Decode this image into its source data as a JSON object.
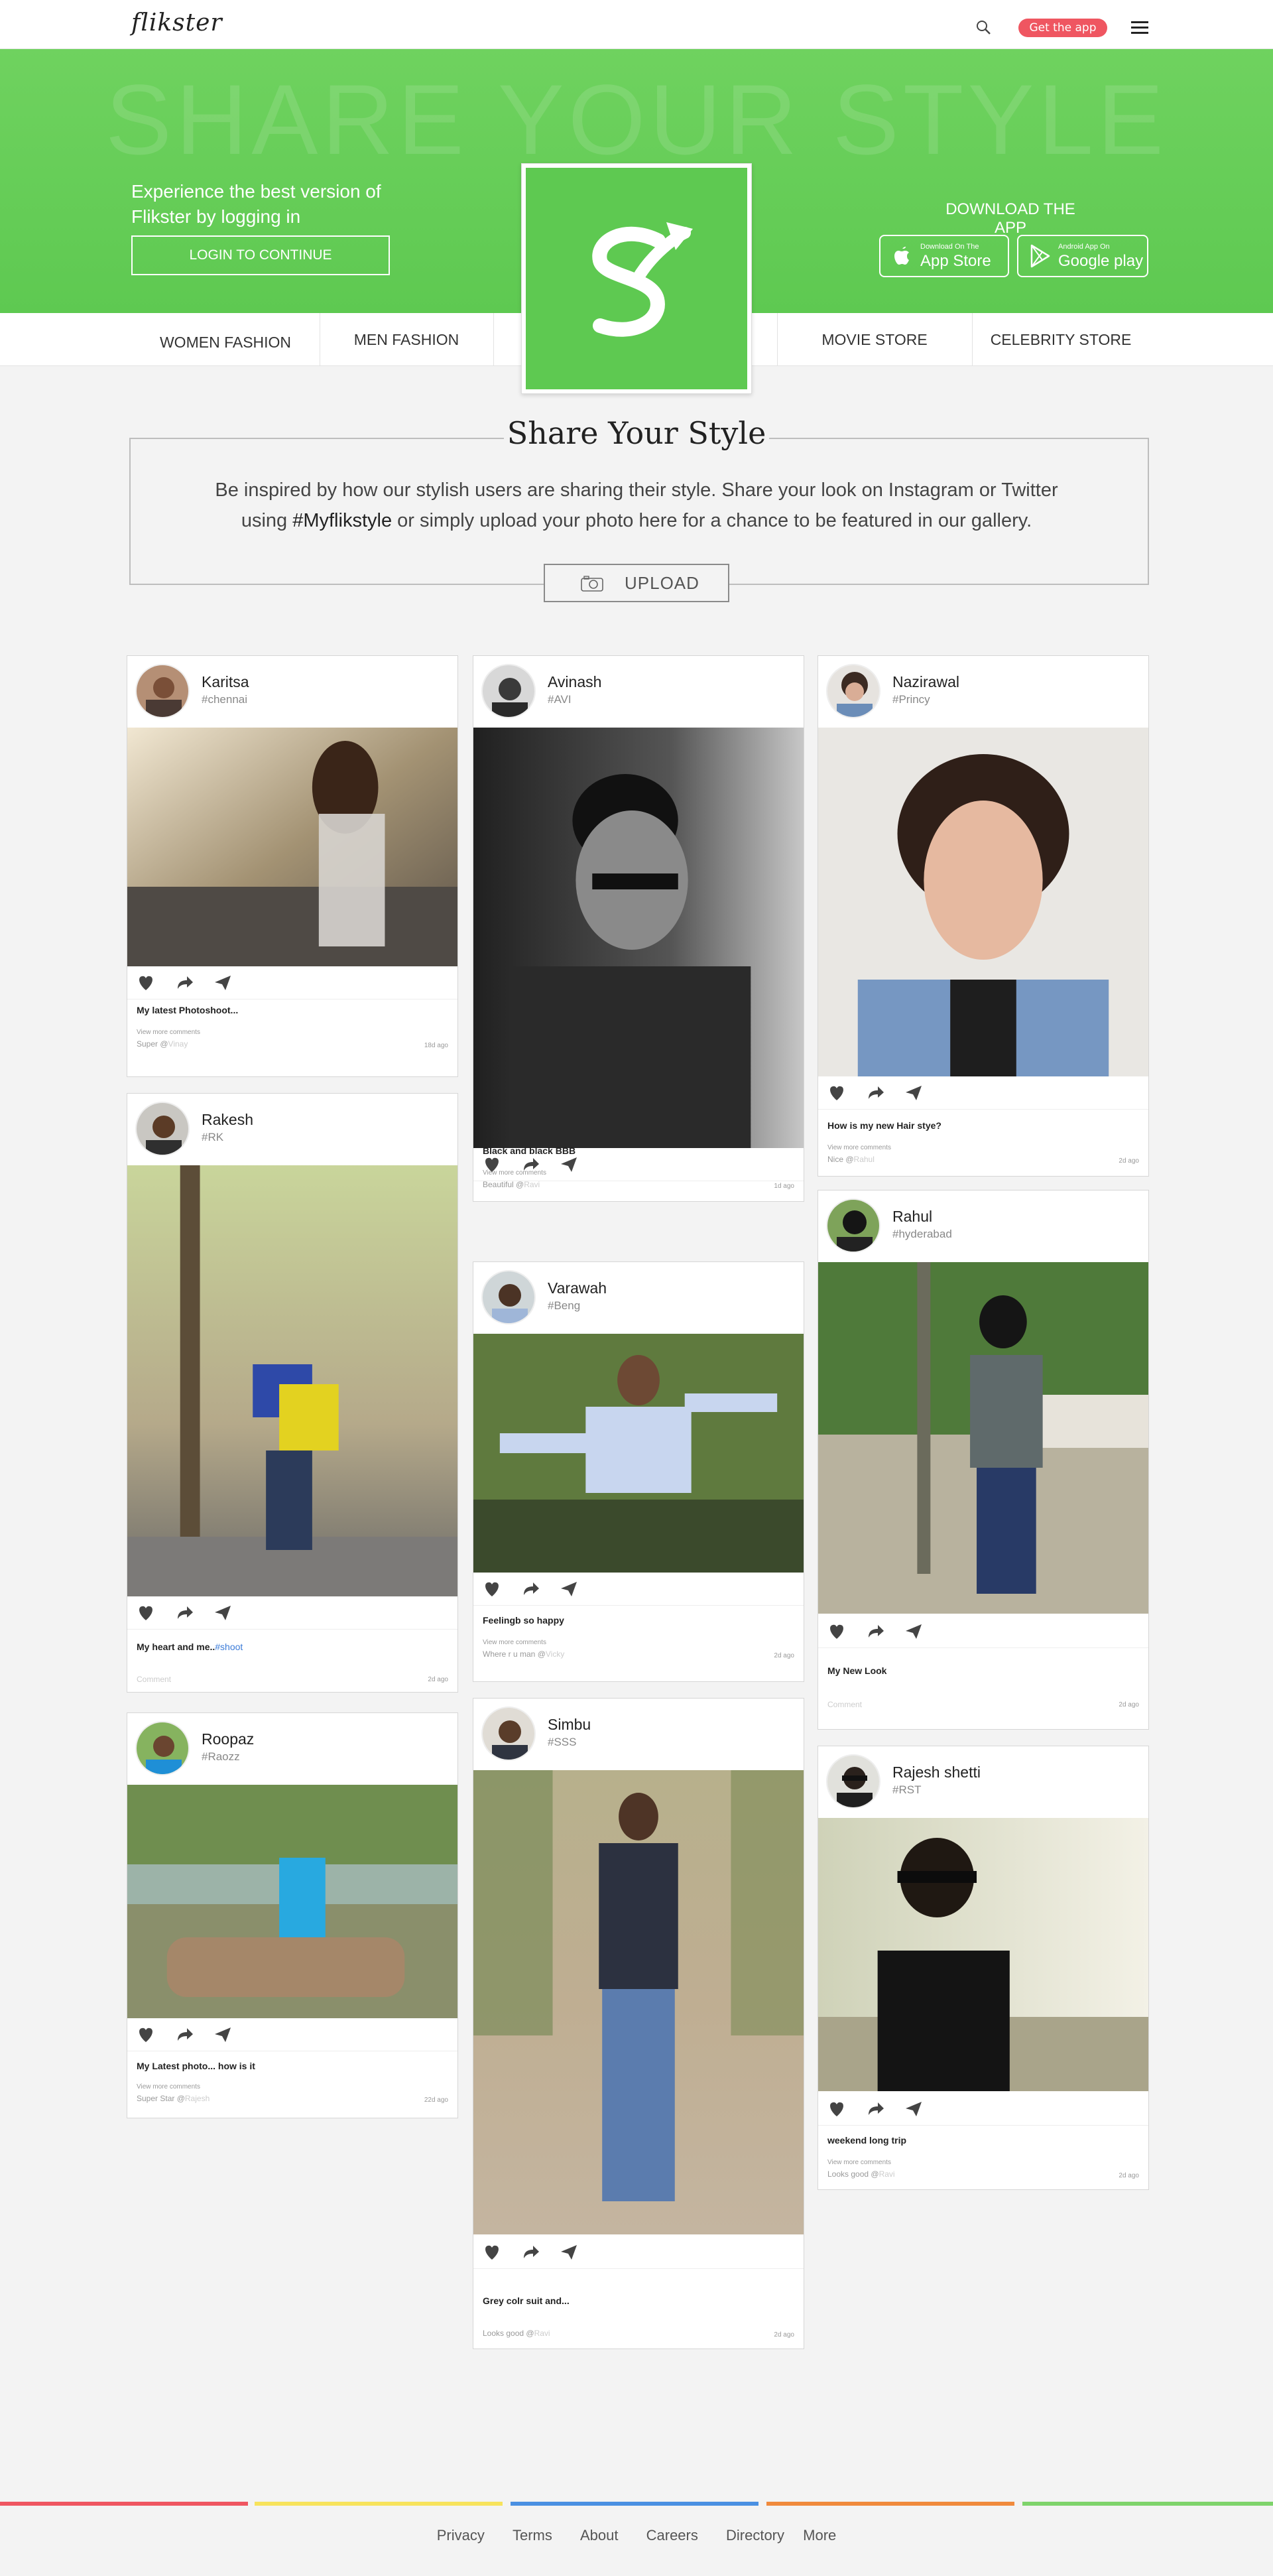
{
  "header": {
    "logo": "flikster",
    "get_app_label": "Get the app"
  },
  "hero": {
    "watermark": "SHARE YOUR STYLE",
    "tagline": "Experience the best version of Flikster by logging in",
    "login_label": "LOGIN TO CONTINUE",
    "download_label": "DOWNLOAD THE APP",
    "appstore_small": "Download On The",
    "appstore_big": "App Store",
    "play_small": "Android App On",
    "play_big": "Google play"
  },
  "categories": {
    "women": "WOMEN FASHION",
    "men": "MEN FASHION",
    "movie": "MOVIE STORE",
    "celebrity": "CELEBRITY STORE"
  },
  "share": {
    "title": "Share Your Style",
    "text_line1": "Be inspired by how our stylish users are sharing their style. Share your look on Instagram or Twitter",
    "text_prefix": "using",
    "hashtag": "#Myflikstyle",
    "text_suffix": "or simply upload your photo here for a chance to be featured in our gallery.",
    "upload_label": "UPLOAD"
  },
  "cards": {
    "karitsa": {
      "name": "Karitsa",
      "tag": "#chennai",
      "caption": "My latest Photoshoot...",
      "view_more": "View more comments",
      "comment": "Super @",
      "comment_user": "Vinay",
      "time": "18d ago"
    },
    "rakesh": {
      "name": "Rakesh",
      "tag": "#RK",
      "caption": "My heart and me..",
      "caption_hash": "#shoot",
      "comment": "Comment",
      "time": "2d ago"
    },
    "roopaz": {
      "name": "Roopaz",
      "tag": "#Raozz",
      "caption": "My Latest photo... how is it",
      "view_more": "View more comments",
      "comment": "Super Star @",
      "comment_user": "Rajesh",
      "time": "22d ago"
    },
    "avinash": {
      "name": "Avinash",
      "tag": "#AVI",
      "caption": "Black and black   BBB",
      "view_more": "View more comments",
      "comment": "Beautiful @",
      "comment_user": "Ravi",
      "time": "1d ago"
    },
    "varawah": {
      "name": "Varawah",
      "tag": "#Beng",
      "caption": "Feelingb so happy",
      "view_more": "View more comments",
      "comment": "Where r u man @",
      "comment_user": "Vicky",
      "time": "2d ago"
    },
    "simbu": {
      "name": "Simbu",
      "tag": "#SSS",
      "caption": "Grey colr suit and...",
      "comment": "Looks good @",
      "comment_user": "Ravi",
      "time": "2d ago"
    },
    "nazirawal": {
      "name": "Nazirawal",
      "tag": "#Princy",
      "caption": "How is my new Hair stye?",
      "view_more": "View more comments",
      "comment": "Nice @",
      "comment_user": "Rahul",
      "time": "2d ago"
    },
    "rahul": {
      "name": "Rahul",
      "tag": "#hyderabad",
      "caption": "My New Look",
      "comment": "Comment",
      "time": "2d ago"
    },
    "rajesh": {
      "name": "Rajesh shetti",
      "tag": "#RST",
      "caption": "weekend long trip",
      "view_more": "View more comments",
      "comment": "Looks good @",
      "comment_user": "Ravi",
      "time": "2d ago"
    }
  },
  "footer": {
    "links": [
      "Privacy",
      "Terms",
      "About",
      "Careers",
      "Directory",
      "More"
    ]
  },
  "colors": {
    "brand_green": "#5ec951",
    "accent_red": "#ef5661",
    "stripe": [
      "#ef5661",
      "#f7e35c",
      "#4a90e2",
      "#f08a3c",
      "#7ed36b"
    ]
  }
}
